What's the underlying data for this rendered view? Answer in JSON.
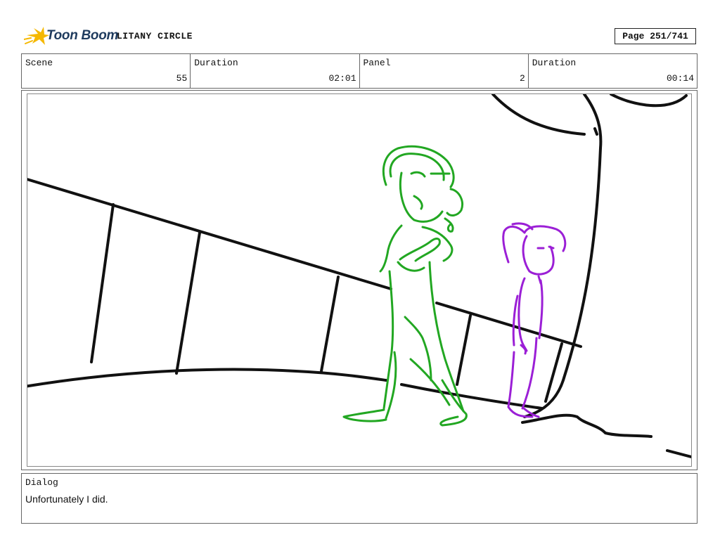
{
  "header": {
    "logo_text": "Toon Boom",
    "project_title": "LITANY CIRCLE",
    "page_indicator": "Page 251/741"
  },
  "meta": {
    "scene_label": "Scene",
    "scene_value": "55",
    "scene_duration_label": "Duration",
    "scene_duration_value": "02:01",
    "panel_label": "Panel",
    "panel_value": "2",
    "panel_duration_label": "Duration",
    "panel_duration_value": "00:14"
  },
  "panel": {
    "colors": {
      "tall_character": "#22a722",
      "small_character": "#9b1fd6",
      "line": "#111111"
    }
  },
  "dialog": {
    "label": "Dialog",
    "text": "Unfortunately I did."
  }
}
